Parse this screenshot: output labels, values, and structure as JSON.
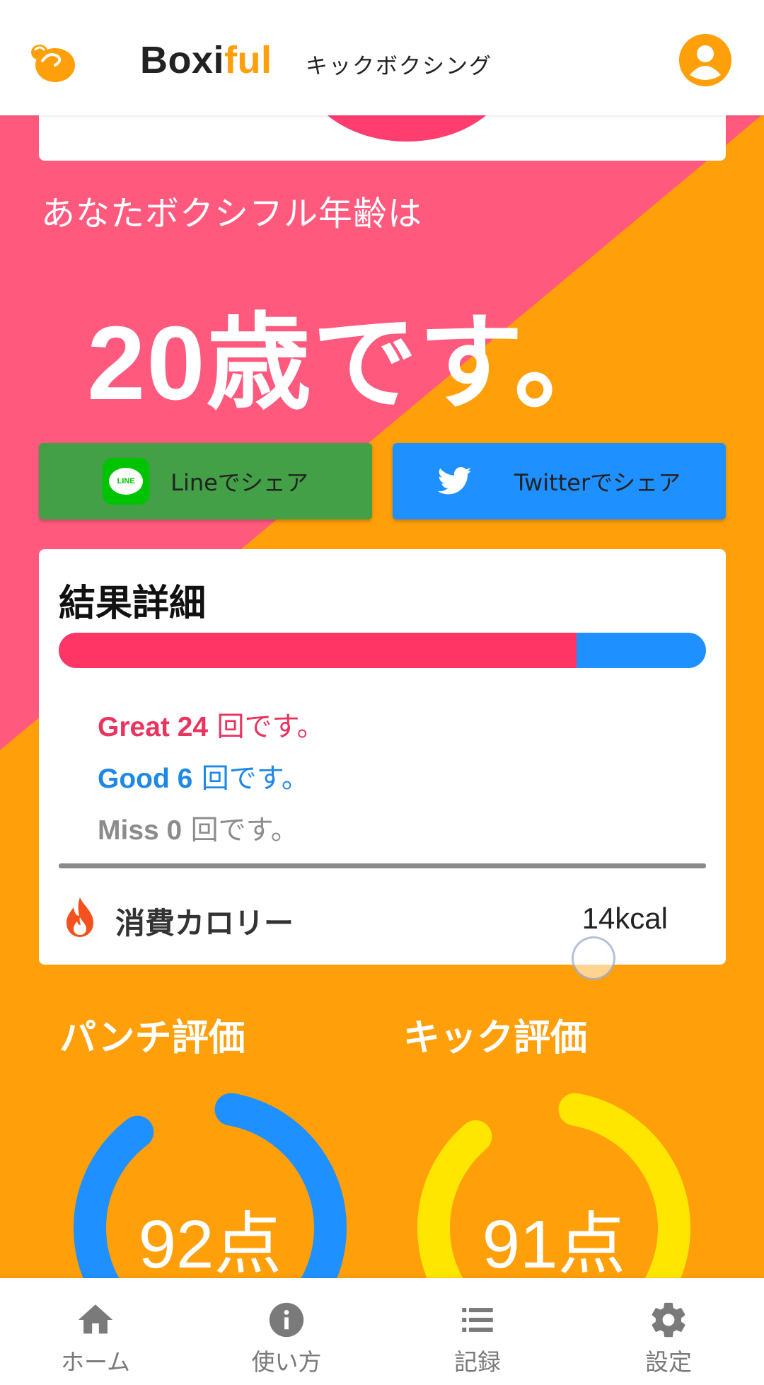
{
  "header": {
    "brand_main": "Boxi",
    "brand_accent": "ful",
    "mode": "キックボクシング",
    "logo_icon": "boxiful-logo-icon",
    "account_icon": "account-circle-icon"
  },
  "result": {
    "intro": "あなたボクシフル年齢は",
    "age": "20歳です。"
  },
  "share": {
    "line_label": "Lineでシェア",
    "line_icon_text": "LINE",
    "twitter_label": "Twitterでシェア"
  },
  "details": {
    "title": "結果詳細",
    "great_fraction": 0.8,
    "great": {
      "label": "Great 24",
      "suffix": " 回です。"
    },
    "good": {
      "label": "Good 6",
      "suffix": " 回です。"
    },
    "miss": {
      "label": "Miss 0",
      "suffix": " 回です。"
    },
    "calorie_label": "消費カロリー",
    "calorie_value": "14kcal"
  },
  "evaluation": {
    "punch_title": "パンチ評価",
    "punch_score": "92点",
    "punch_value": 92,
    "kick_title": "キック評価",
    "kick_score": "91点",
    "kick_value": 91
  },
  "nav": {
    "home": "ホーム",
    "howto": "使い方",
    "records": "記録",
    "settings": "設定"
  },
  "colors": {
    "pink": "#FF5A7E",
    "orange": "#FF9F0A",
    "line_green": "#43A047",
    "twitter_blue": "#1E90FF",
    "great": "#E8345E",
    "good": "#1E88E5",
    "miss": "#8C8C8C",
    "punch_gauge": "#1E90FF",
    "kick_gauge": "#FFE600"
  }
}
